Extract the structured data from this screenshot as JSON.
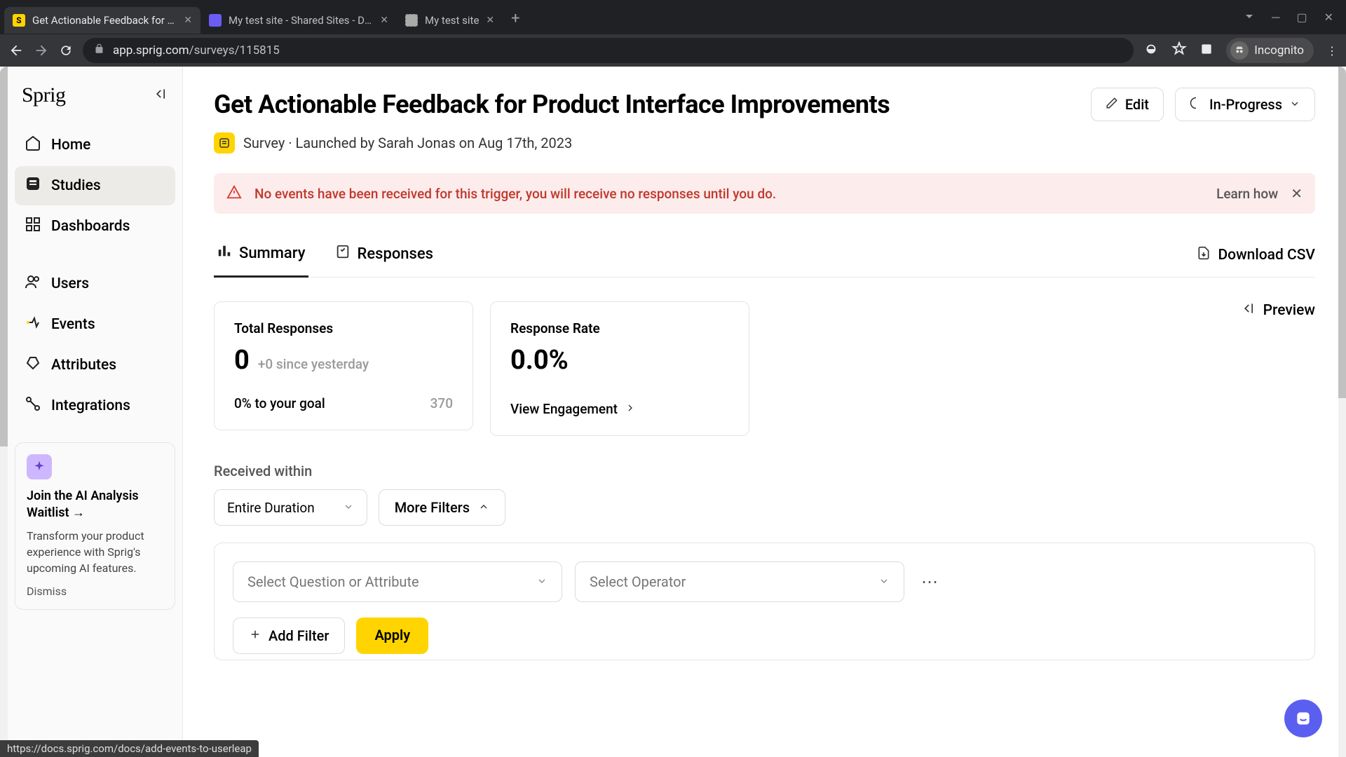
{
  "browser": {
    "tabs": [
      {
        "title": "Get Actionable Feedback for Pro"
      },
      {
        "title": "My test site - Shared Sites - Dash"
      },
      {
        "title": "My test site"
      }
    ],
    "url_host": "app.sprig.com",
    "url_path": "/surveys/115815",
    "incognito_label": "Incognito"
  },
  "status_bar_url": "https://docs.sprig.com/docs/add-events-to-userleap",
  "sidebar": {
    "logo": "Sprig",
    "items": [
      {
        "label": "Home"
      },
      {
        "label": "Studies"
      },
      {
        "label": "Dashboards"
      },
      {
        "label": "Users"
      },
      {
        "label": "Events"
      },
      {
        "label": "Attributes"
      },
      {
        "label": "Integrations"
      }
    ],
    "promo": {
      "title": "Join the AI Analysis Waitlist →",
      "body": "Transform your product experience with Sprig's upcoming AI features.",
      "dismiss": "Dismiss"
    }
  },
  "header": {
    "title": "Get Actionable Feedback for Product Interface Improvements",
    "edit_label": "Edit",
    "status_label": "In-Progress",
    "type_label": "Survey",
    "meta_sep": "·",
    "launched_by": "Launched by Sarah Jonas on Aug 17th, 2023"
  },
  "alert": {
    "text": "No events have been received for this trigger, you will receive no responses until you do.",
    "link": "Learn how"
  },
  "tabs": {
    "summary": "Summary",
    "responses": "Responses",
    "download_csv": "Download CSV"
  },
  "cards": {
    "total_responses": {
      "label": "Total Responses",
      "value": "0",
      "since": "+0 since yesterday",
      "goal_pct": "0% to your goal",
      "goal_val": "370"
    },
    "response_rate": {
      "label": "Response Rate",
      "value": "0.0%",
      "view_engagement": "View Engagement"
    },
    "preview": "Preview"
  },
  "filters": {
    "received_within": "Received within",
    "duration_value": "Entire Duration",
    "more_filters": "More Filters",
    "select_question": "Select Question or Attribute",
    "select_operator": "Select Operator",
    "add_filter": "Add Filter",
    "apply": "Apply"
  }
}
